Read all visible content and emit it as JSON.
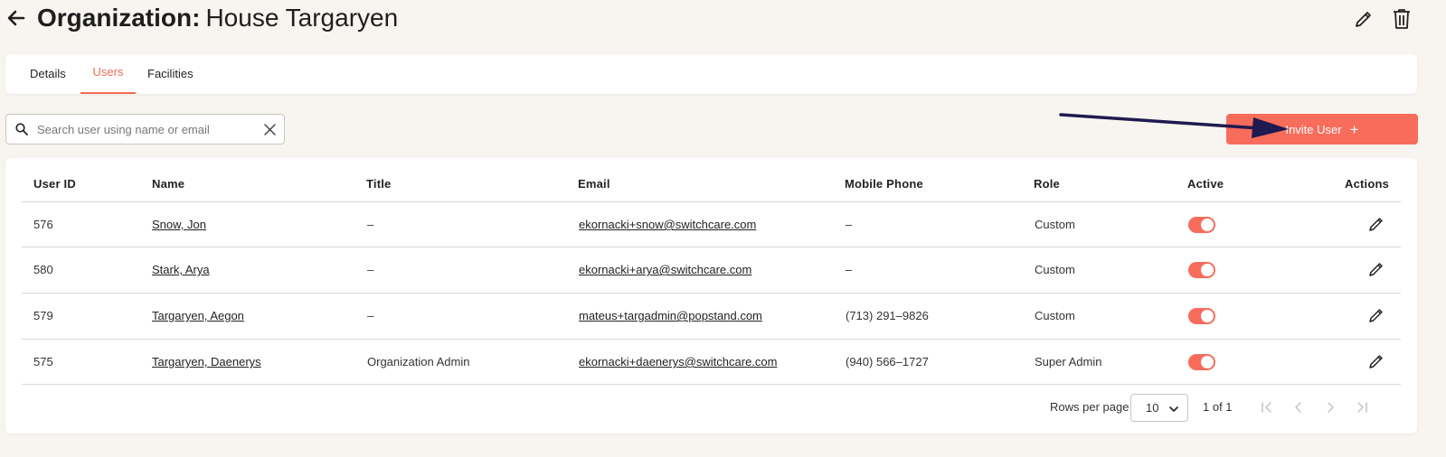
{
  "header": {
    "title_prefix": "Organization:",
    "title_name": "House Targaryen"
  },
  "tabs": [
    {
      "label": "Details",
      "active": false
    },
    {
      "label": "Users",
      "active": true
    },
    {
      "label": "Facilities",
      "active": false
    }
  ],
  "search": {
    "placeholder": "Search user using name or email",
    "value": ""
  },
  "invite_button": {
    "label": "Invite User",
    "icon": "plus-icon"
  },
  "colors": {
    "accent": "#f86c5c",
    "annotation_arrow": "#1f1a4f",
    "background": "#f8f5f1"
  },
  "table": {
    "columns": [
      "User ID",
      "Name",
      "Title",
      "Email",
      "Mobile Phone",
      "Role",
      "Active",
      "Actions"
    ],
    "rows": [
      {
        "id": "576",
        "name": "Snow, Jon",
        "title": "–",
        "email": "ekornacki+snow@switchcare.com",
        "phone": "–",
        "role": "Custom",
        "active": true
      },
      {
        "id": "580",
        "name": "Stark, Arya",
        "title": "–",
        "email": "ekornacki+arya@switchcare.com",
        "phone": "–",
        "role": "Custom",
        "active": true
      },
      {
        "id": "579",
        "name": "Targaryen, Aegon",
        "title": "–",
        "email": "mateus+targadmin@popstand.com",
        "phone": "(713) 291–9826",
        "role": "Custom",
        "active": true
      },
      {
        "id": "575",
        "name": "Targaryen, Daenerys",
        "title": "Organization Admin",
        "email": "ekornacki+daenerys@switchcare.com",
        "phone": "(940) 566–1727",
        "role": "Super Admin",
        "active": true
      }
    ]
  },
  "pagination": {
    "rows_per_page_label": "Rows per page",
    "rows_per_page_value": "10",
    "page_info": "1 of 1"
  }
}
